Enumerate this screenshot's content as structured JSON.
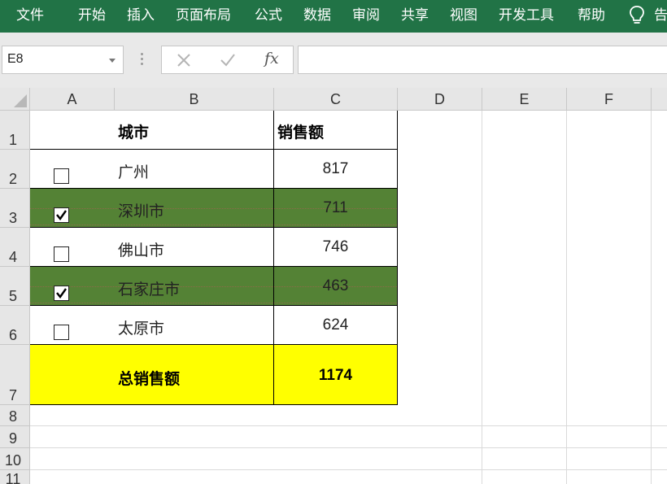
{
  "ribbon": {
    "tabs": [
      "文件",
      "开始",
      "插入",
      "页面布局",
      "公式",
      "数据",
      "审阅",
      "共享",
      "视图",
      "开发工具",
      "帮助"
    ],
    "tell_me": "告"
  },
  "formula_bar": {
    "name_box": "E8",
    "fx_label": "fx",
    "formula": ""
  },
  "columns": [
    "A",
    "B",
    "C",
    "D",
    "E",
    "F"
  ],
  "rows": [
    "1",
    "2",
    "3",
    "4",
    "5",
    "6",
    "7",
    "8",
    "9",
    "10",
    "11"
  ],
  "table": {
    "header": {
      "city": "城市",
      "sales": "销售额"
    },
    "items": [
      {
        "checked": false,
        "city": "广州",
        "sales": "817"
      },
      {
        "checked": true,
        "city": "深圳市",
        "sales": "711"
      },
      {
        "checked": false,
        "city": "佛山市",
        "sales": "746"
      },
      {
        "checked": true,
        "city": "石家庄市",
        "sales": "463"
      },
      {
        "checked": false,
        "city": "太原市",
        "sales": "624"
      }
    ],
    "total": {
      "label": "总销售额",
      "value": "1174"
    }
  },
  "colors": {
    "ribbon": "#217346",
    "checked_row": "#548235",
    "total_row": "#ffff00"
  }
}
